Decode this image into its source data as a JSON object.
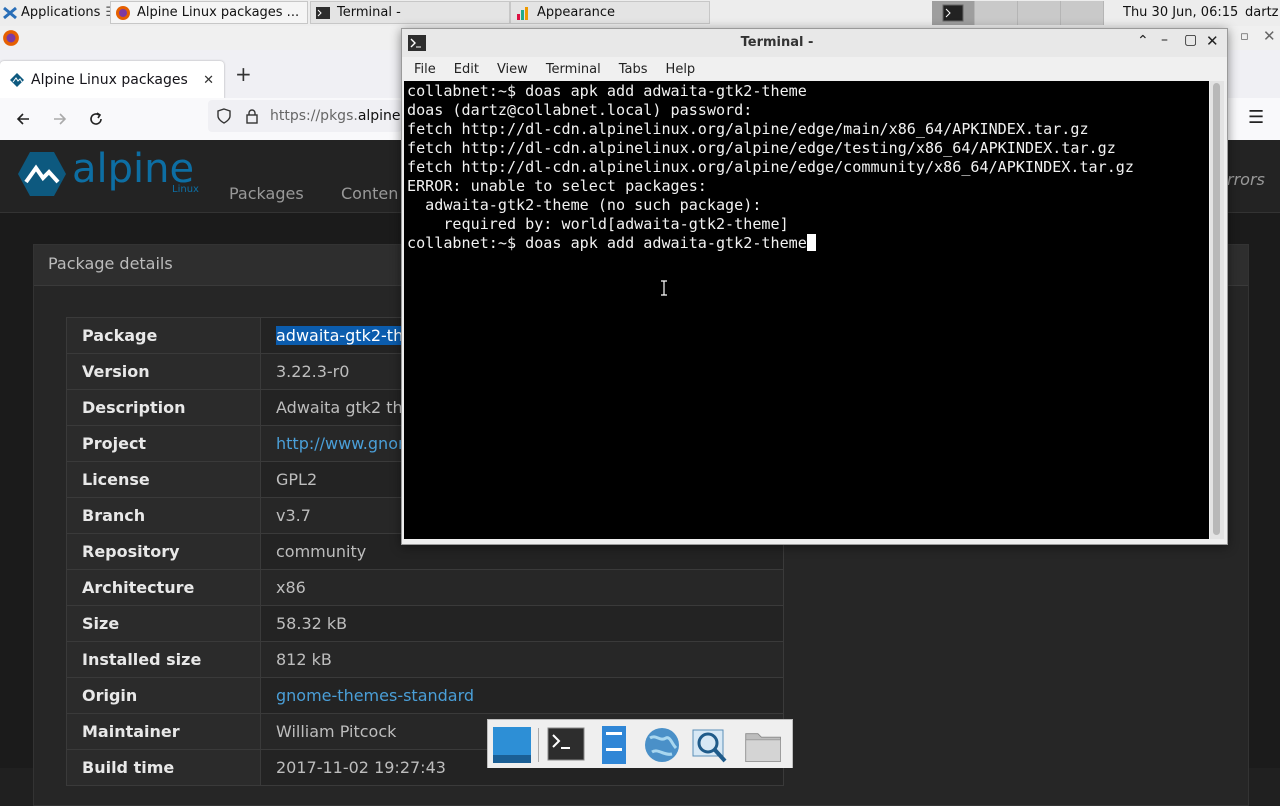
{
  "top_panel": {
    "applications_label": "Applications",
    "tasks": [
      {
        "label": "Alpine Linux packages ...",
        "icon": "firefox-icon"
      },
      {
        "label": "Terminal -",
        "icon": "terminal-icon"
      },
      {
        "label": "Appearance",
        "icon": "appearance-icon"
      }
    ],
    "clock": "Thu 30 Jun, 06:15",
    "user": "dartz"
  },
  "firefox": {
    "tab_title": "Alpine Linux packages",
    "url_prefix": "https://pkgs.",
    "url_domain": "alpine",
    "site_nav": [
      "Packages",
      "Conten"
    ],
    "mirrors_text": "rrors",
    "logo_text": "alpine",
    "logo_sub": "Linux",
    "panel_title": "Package details",
    "details": [
      {
        "key": "Package",
        "value": "adwaita-gtk2-th"
      },
      {
        "key": "Version",
        "value": "3.22.3-r0"
      },
      {
        "key": "Description",
        "value": "Adwaita gtk2 th"
      },
      {
        "key": "Project",
        "value": "http://www.gnon"
      },
      {
        "key": "License",
        "value": "GPL2"
      },
      {
        "key": "Branch",
        "value": "v3.7"
      },
      {
        "key": "Repository",
        "value": "community"
      },
      {
        "key": "Architecture",
        "value": "x86"
      },
      {
        "key": "Size",
        "value": "58.32 kB"
      },
      {
        "key": "Installed size",
        "value": "812 kB"
      },
      {
        "key": "Origin",
        "value": "gnome-themes-standard"
      },
      {
        "key": "Maintainer",
        "value": "William Pitcock"
      },
      {
        "key": "Build time",
        "value": "2017-11-02 19:27:43"
      }
    ]
  },
  "terminal": {
    "title": "Terminal -",
    "menu": [
      "File",
      "Edit",
      "View",
      "Terminal",
      "Tabs",
      "Help"
    ],
    "lines": [
      "collabnet:~$ doas apk add adwaita-gtk2-theme",
      "doas (dartz@collabnet.local) password:",
      "fetch http://dl-cdn.alpinelinux.org/alpine/edge/main/x86_64/APKINDEX.tar.gz",
      "fetch http://dl-cdn.alpinelinux.org/alpine/edge/testing/x86_64/APKINDEX.tar.gz",
      "fetch http://dl-cdn.alpinelinux.org/alpine/edge/community/x86_64/APKINDEX.tar.gz",
      "ERROR: unable to select packages:",
      "  adwaita-gtk2-theme (no such package):",
      "    required by: world[adwaita-gtk2-theme]",
      "collabnet:~$ doas apk add adwaita-gtk2-theme"
    ]
  },
  "dock": {
    "items": [
      "desktop-icon",
      "terminal-icon",
      "file-manager-icon",
      "web-browser-icon",
      "search-icon",
      "folder-icon"
    ]
  }
}
